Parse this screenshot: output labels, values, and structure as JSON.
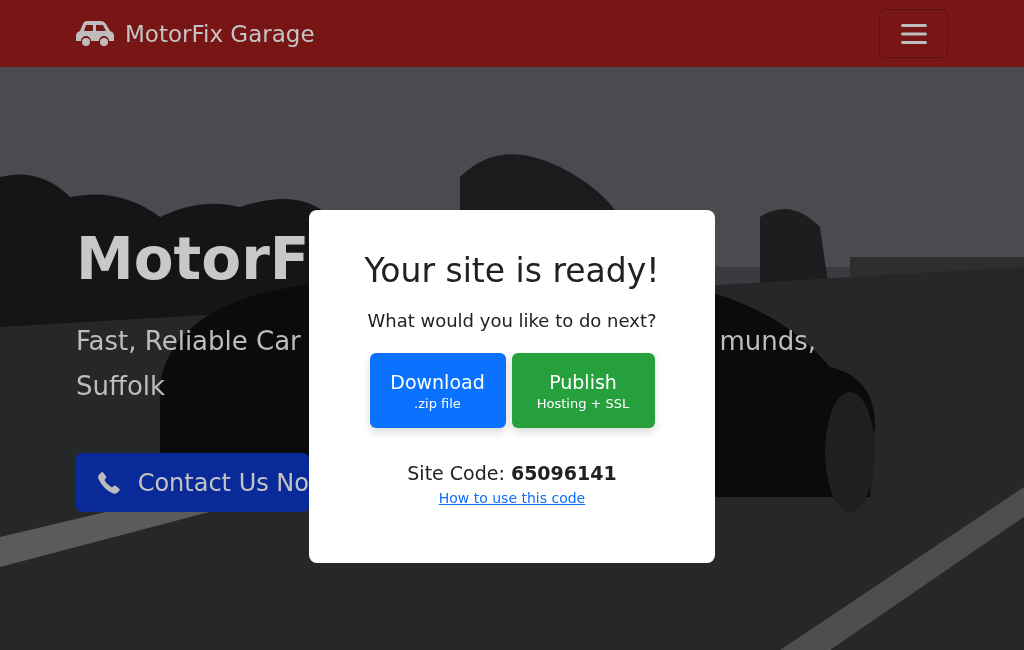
{
  "navbar": {
    "brand": "MotorFix Garage"
  },
  "hero": {
    "kind": "picture",
    "heading": "MotorF",
    "subtitle_left": "Fast, Reliable Car",
    "subtitle_right": "munds,",
    "subtitle_line_2": "Suffolk",
    "contact_button": "Contact Us No"
  },
  "modal": {
    "title": "Your site is ready!",
    "prompt": "What would you like to do next?",
    "actions": [
      {
        "kind": "download",
        "label": "Download",
        "detail": ".zip file"
      },
      {
        "kind": "publish",
        "label": "Publish",
        "detail": "Hosting + SSL"
      }
    ],
    "site_code": "Site Code: **65096141**",
    "help_link": "How to use this code"
  }
}
